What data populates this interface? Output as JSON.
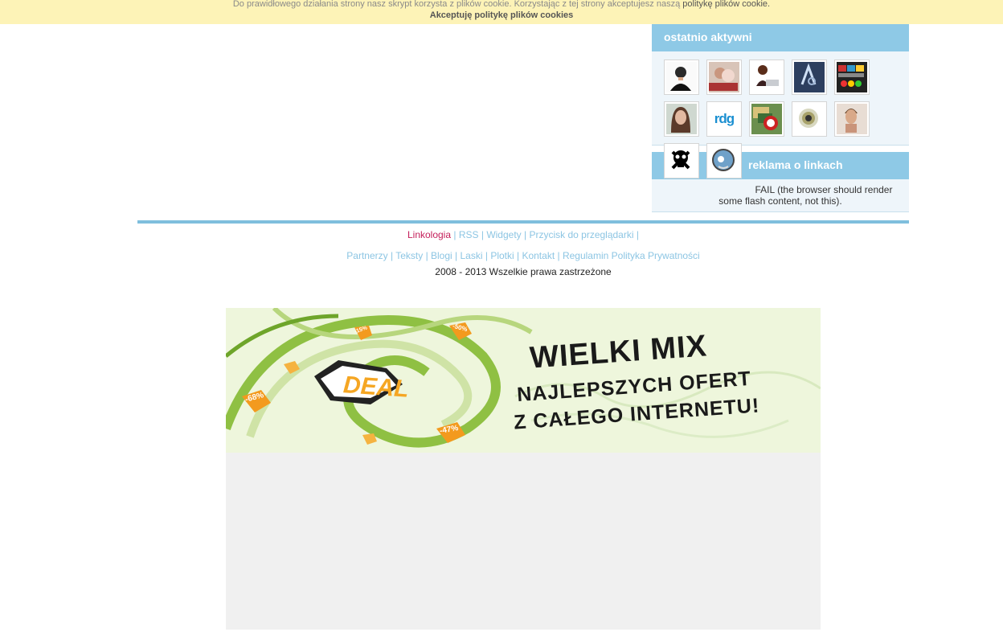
{
  "cookie": {
    "message": "Do prawidłowego działania strony nasz skrypt korzysta z plików cookie. Korzystając z tej strony akceptujesz naszą",
    "policy_link": "politykę plików cookie.",
    "accept": "Akceptuję politykę plików cookies"
  },
  "sidebar": {
    "recent_title": "ostatnio aktywni",
    "ads_title": "reklama o linkach",
    "flash_fail": "FAIL (the browser should render some flash content, not this).",
    "avatar_text": {
      "rd": "rdg"
    }
  },
  "footer": {
    "links_row1": [
      "Linkologia",
      "RSS",
      "Widgety",
      "Przycisk do przeglądarki"
    ],
    "links_row2": [
      "Partnerzy",
      "Teksty",
      "Blogi",
      "Laski",
      "Plotki",
      "Kontakt",
      "Regulamin",
      "Polityka Prywatności"
    ],
    "copyright": "2008 - 2013 Wszelkie prawa zastrzeżone"
  },
  "banner": {
    "brand": "DEAL",
    "headline1": "WIELKI MIX",
    "headline2": "NAJLEPSZYCH OFERT",
    "headline3": "Z CAŁEGO INTERNETU!",
    "tags": [
      "-15%",
      "-50%",
      "-68%",
      "-47%"
    ]
  },
  "colors": {
    "cookie_bg": "#fdf3b7",
    "widget_head": "#8ec9e6",
    "widget_body": "#eef5fa",
    "footer_rule": "#7fbfdd",
    "link": "#8cc5e3",
    "brand_link": "#c41e5a"
  }
}
